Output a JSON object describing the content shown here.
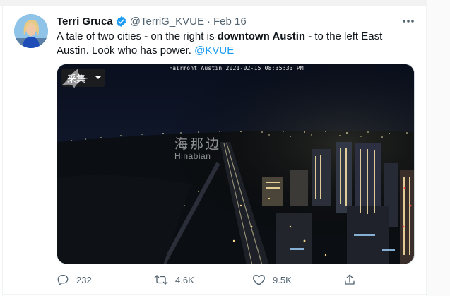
{
  "tweet": {
    "author": {
      "display_name": "Terri Gruca",
      "handle": "@TerriG_KVUE"
    },
    "separator": "·",
    "date": "Feb 16",
    "text_part1": "A tale of two cities - on the right is ",
    "text_bold": "downtown Austin",
    "text_part2": " - to the left East Austin. Look who has power. ",
    "mention": "@KVUE"
  },
  "media": {
    "camera_caption": "Fairmont Austin  2021-02-15  08:35:33 PM",
    "collect_label": "采集",
    "watermark_cn": "海那边",
    "watermark_en": "Hinabian"
  },
  "actions": {
    "reply_count": "232",
    "retweet_count": "4.6K",
    "like_count": "9.5K"
  },
  "colors": {
    "accent": "#1d9bf0",
    "muted": "#536471",
    "text": "#0f1419"
  },
  "icons": [
    "verified-badge-icon",
    "more-icon",
    "reply-icon",
    "retweet-icon",
    "like-icon",
    "share-icon"
  ]
}
